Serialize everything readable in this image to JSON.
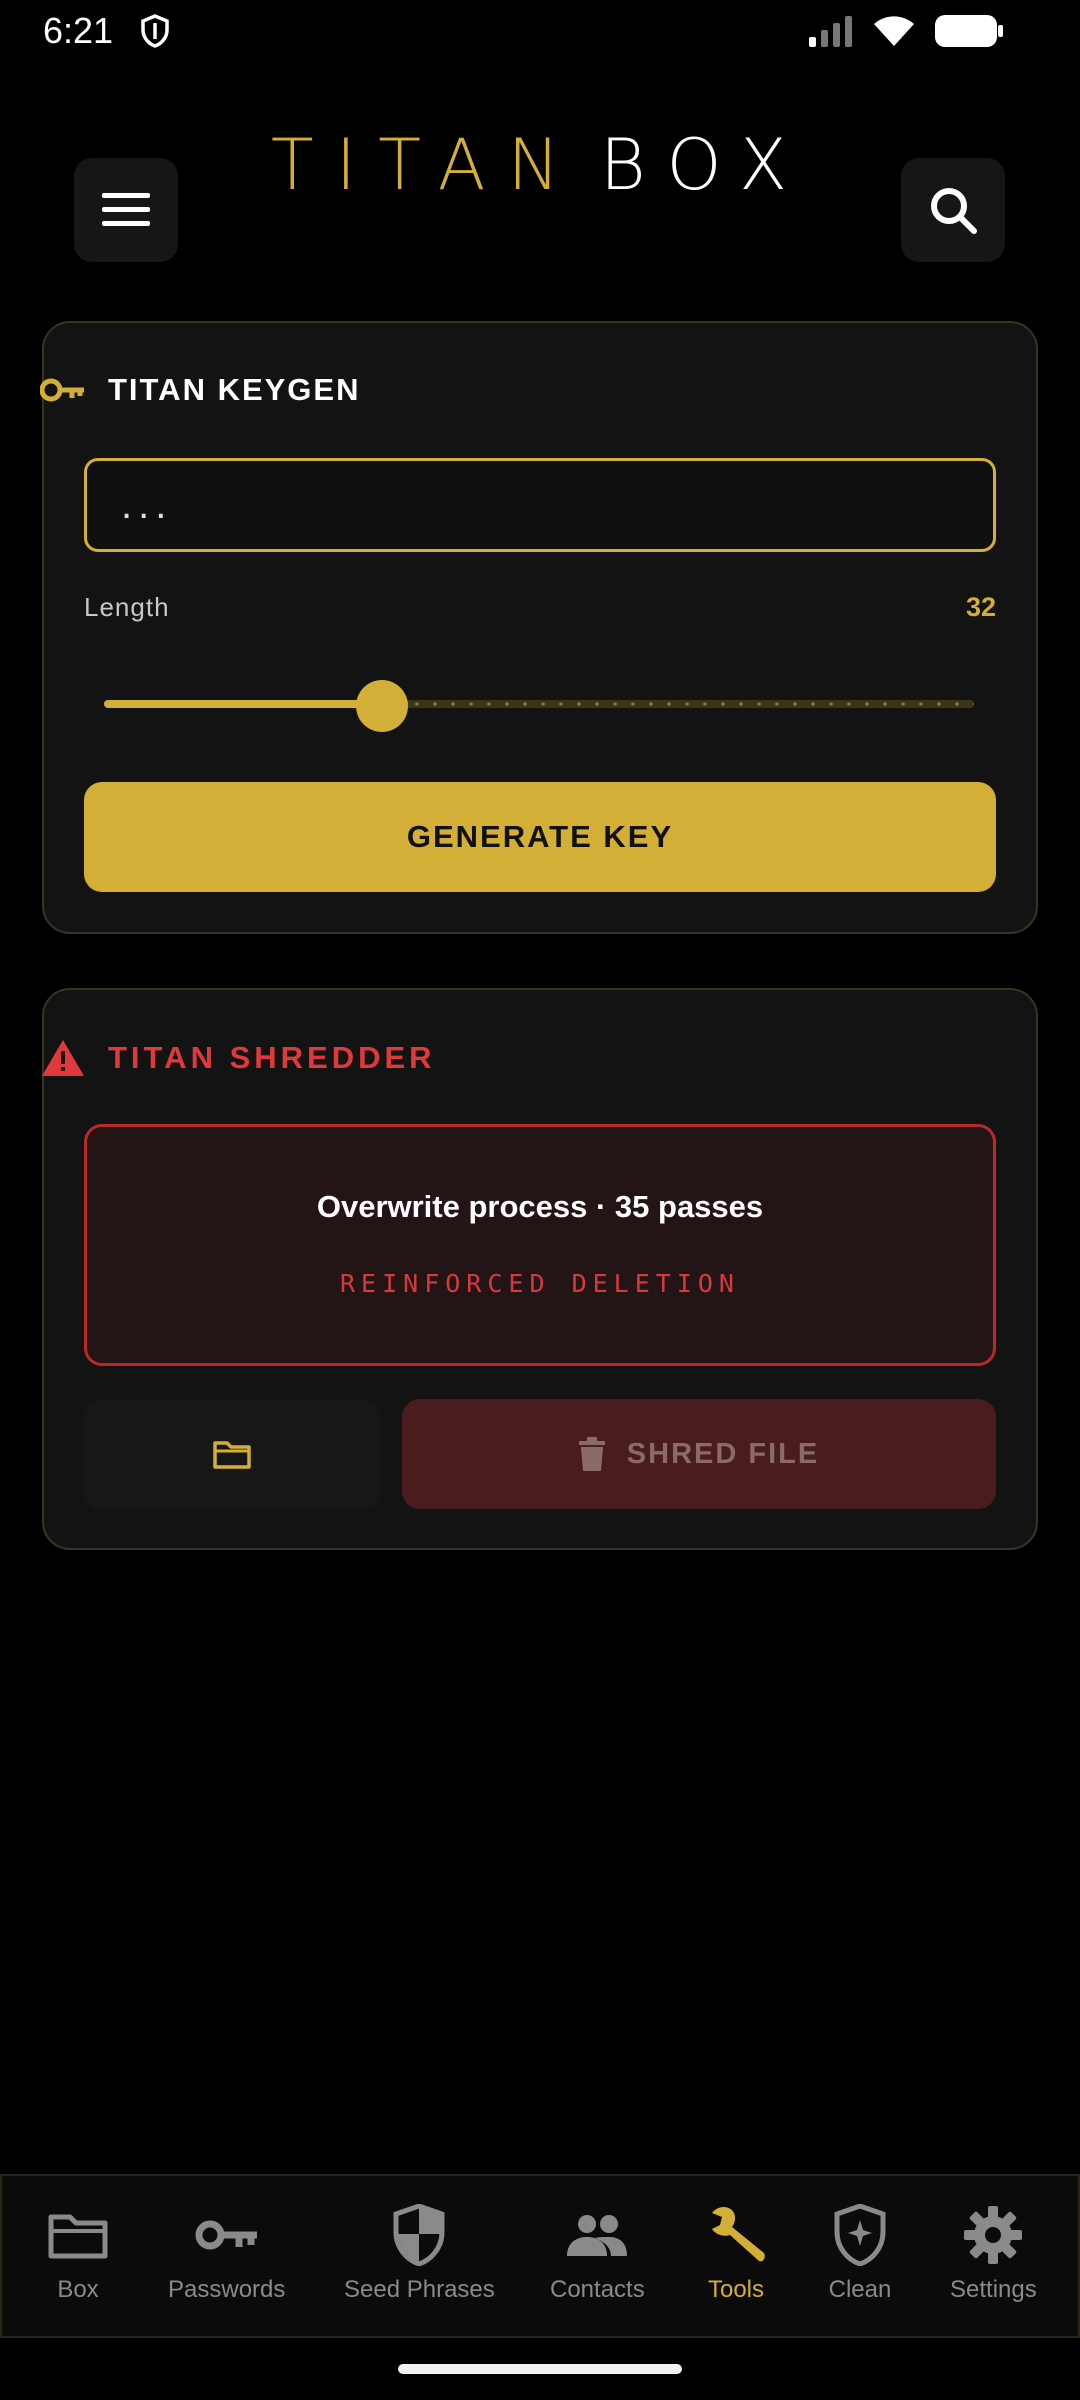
{
  "status": {
    "time": "6:21"
  },
  "app": {
    "title_part1": "TITAN",
    "title_part2": "BOX"
  },
  "keygen": {
    "title": "TITAN KEYGEN",
    "input_value": "...",
    "length_label": "Length",
    "length_value": "32",
    "slider_fraction": 0.32,
    "generate_label": "GENERATE KEY"
  },
  "shredder": {
    "title": "TITAN SHREDDER",
    "warning_main": "Overwrite process · 35 passes",
    "warning_sub": "REINFORCED DELETION",
    "shred_label": "SHRED FILE"
  },
  "nav": {
    "items": [
      {
        "label": "Box",
        "icon": "folder-icon"
      },
      {
        "label": "Passwords",
        "icon": "key-icon"
      },
      {
        "label": "Seed Phrases",
        "icon": "shield-half-icon"
      },
      {
        "label": "Contacts",
        "icon": "people-icon"
      },
      {
        "label": "Tools",
        "icon": "wrench-icon"
      },
      {
        "label": "Clean",
        "icon": "shield-sparkle-icon"
      },
      {
        "label": "Settings",
        "icon": "gear-icon"
      }
    ],
    "active": "Tools"
  },
  "colors": {
    "accent": "#d4af37",
    "danger": "#e0393b",
    "background": "#000000"
  }
}
